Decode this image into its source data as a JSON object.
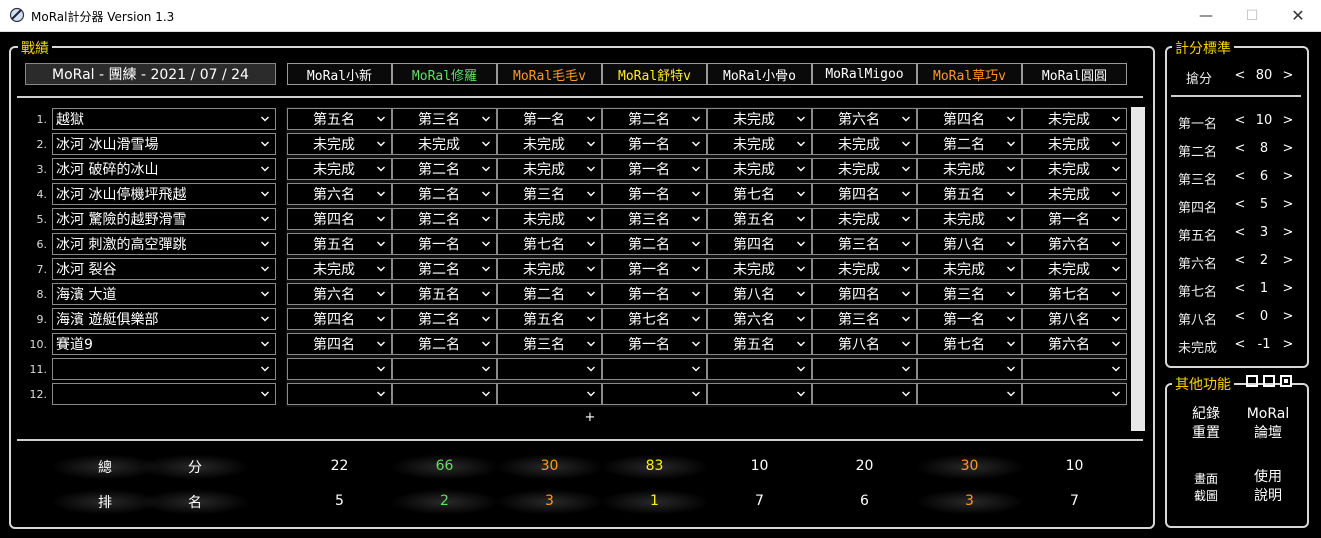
{
  "window": {
    "title": "MoRal計分器 Version 1.3"
  },
  "record": {
    "label": "戰績",
    "date_title": "MoRal - 團練 - 2021 / 07 / 24"
  },
  "players": [
    {
      "name": "MoRal小新",
      "color": "#ffffff"
    },
    {
      "name": "MoRal修羅",
      "color": "#66dd66"
    },
    {
      "name": "MoRal毛毛v",
      "color": "#ff9922"
    },
    {
      "name": "MoRal舒特v",
      "color": "#ffee22"
    },
    {
      "name": "MoRal小骨o",
      "color": "#ffffff"
    },
    {
      "name": "MoRalMigoo",
      "color": "#ffffff"
    },
    {
      "name": "MoRal草巧v",
      "color": "#ff9922"
    },
    {
      "name": "MoRal圓圓",
      "color": "#ffffff"
    }
  ],
  "rows": [
    {
      "num": "1.",
      "track": "越獄",
      "ranks": [
        "第五名",
        "第三名",
        "第一名",
        "第二名",
        "未完成",
        "第六名",
        "第四名",
        "未完成"
      ]
    },
    {
      "num": "2.",
      "track": "冰河 冰山滑雪場",
      "ranks": [
        "未完成",
        "未完成",
        "未完成",
        "第一名",
        "未完成",
        "未完成",
        "第二名",
        "未完成"
      ]
    },
    {
      "num": "3.",
      "track": "冰河 破碎的冰山",
      "ranks": [
        "未完成",
        "第二名",
        "未完成",
        "第一名",
        "未完成",
        "未完成",
        "未完成",
        "未完成"
      ]
    },
    {
      "num": "4.",
      "track": "冰河 冰山停機坪飛越",
      "ranks": [
        "第六名",
        "第二名",
        "第三名",
        "第一名",
        "第七名",
        "第四名",
        "第五名",
        "未完成"
      ]
    },
    {
      "num": "5.",
      "track": "冰河 驚險的越野滑雪",
      "ranks": [
        "第四名",
        "第二名",
        "未完成",
        "第三名",
        "第五名",
        "未完成",
        "未完成",
        "第一名"
      ]
    },
    {
      "num": "6.",
      "track": "冰河 刺激的高空彈跳",
      "ranks": [
        "第五名",
        "第一名",
        "第七名",
        "第二名",
        "第四名",
        "第三名",
        "第八名",
        "第六名"
      ]
    },
    {
      "num": "7.",
      "track": "冰河 裂谷",
      "ranks": [
        "未完成",
        "第二名",
        "未完成",
        "第一名",
        "未完成",
        "未完成",
        "未完成",
        "未完成"
      ]
    },
    {
      "num": "8.",
      "track": "海濱 大道",
      "ranks": [
        "第六名",
        "第五名",
        "第二名",
        "第一名",
        "第八名",
        "第四名",
        "第三名",
        "第七名"
      ]
    },
    {
      "num": "9.",
      "track": "海濱 遊艇俱樂部",
      "ranks": [
        "第四名",
        "第二名",
        "第五名",
        "第七名",
        "第六名",
        "第三名",
        "第一名",
        "第八名"
      ]
    },
    {
      "num": "10.",
      "track": "賽道9",
      "ranks": [
        "第四名",
        "第二名",
        "第三名",
        "第一名",
        "第五名",
        "第八名",
        "第七名",
        "第六名"
      ]
    },
    {
      "num": "11.",
      "track": "",
      "ranks": [
        "",
        "",
        "",
        "",
        "",
        "",
        "",
        ""
      ]
    },
    {
      "num": "12.",
      "track": "",
      "ranks": [
        "",
        "",
        "",
        "",
        "",
        "",
        "",
        ""
      ]
    }
  ],
  "add_row_label": "+",
  "summary": {
    "total_label_1": "總",
    "total_label_2": "分",
    "rank_label_1": "排",
    "rank_label_2": "名",
    "totals": [
      "22",
      "66",
      "30",
      "83",
      "10",
      "20",
      "30",
      "10"
    ],
    "rankings": [
      "5",
      "2",
      "3",
      "1",
      "7",
      "6",
      "3",
      "7"
    ]
  },
  "scoring": {
    "label": "計分標準",
    "grab": {
      "label": "搶分",
      "value": "80"
    },
    "places": [
      {
        "label": "第一名",
        "value": "10"
      },
      {
        "label": "第二名",
        "value": "8"
      },
      {
        "label": "第三名",
        "value": "6"
      },
      {
        "label": "第四名",
        "value": "5"
      },
      {
        "label": "第五名",
        "value": "3"
      },
      {
        "label": "第六名",
        "value": "2"
      },
      {
        "label": "第七名",
        "value": "1"
      },
      {
        "label": "第八名",
        "value": "0"
      },
      {
        "label": "未完成",
        "value": "-1"
      }
    ],
    "dec": "<",
    "inc": ">"
  },
  "functions": {
    "label": "其他功能",
    "reset": [
      "紀錄",
      "重置"
    ],
    "forum": [
      "MoRal",
      "論壇"
    ],
    "screenshot": [
      "畫面",
      "截圖"
    ],
    "help": [
      "使用",
      "說明"
    ]
  }
}
